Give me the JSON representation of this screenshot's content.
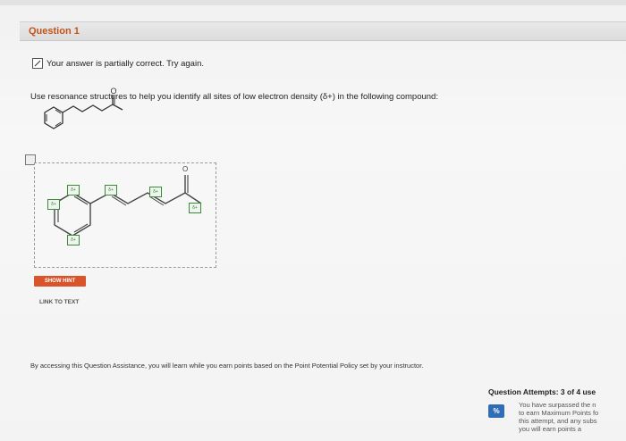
{
  "question": {
    "title": "Question 1",
    "feedback_text": "Your answer is partially correct.  Try again.",
    "prompt": "Use resonance structures to help you identify all sites of low electron density (δ+) in the following compound:"
  },
  "drawing": {
    "delta_labels": [
      "δ+",
      "δ+",
      "δ+",
      "δ+",
      "δ+",
      "δ+"
    ],
    "oxygen_label": "O"
  },
  "buttons": {
    "show_hint": "SHOW HINT",
    "link_to_text": "LINK TO TEXT"
  },
  "assistance_text": "By accessing this Question Assistance, you will learn while you earn points based on the Point Potential Policy set by your instructor.",
  "attempts": {
    "label": "Question Attempts: 3 of 4 use",
    "icon": "%",
    "message": "You have surpassed the n\nto earn Maximum Points fo\nthis attempt, and any subs\nyou will earn points a"
  },
  "colors": {
    "question_title": "#c0541a",
    "hint_button": "#d9542b",
    "percent_icon": "#2f6db5",
    "delta_box": "#3a8a3a"
  }
}
